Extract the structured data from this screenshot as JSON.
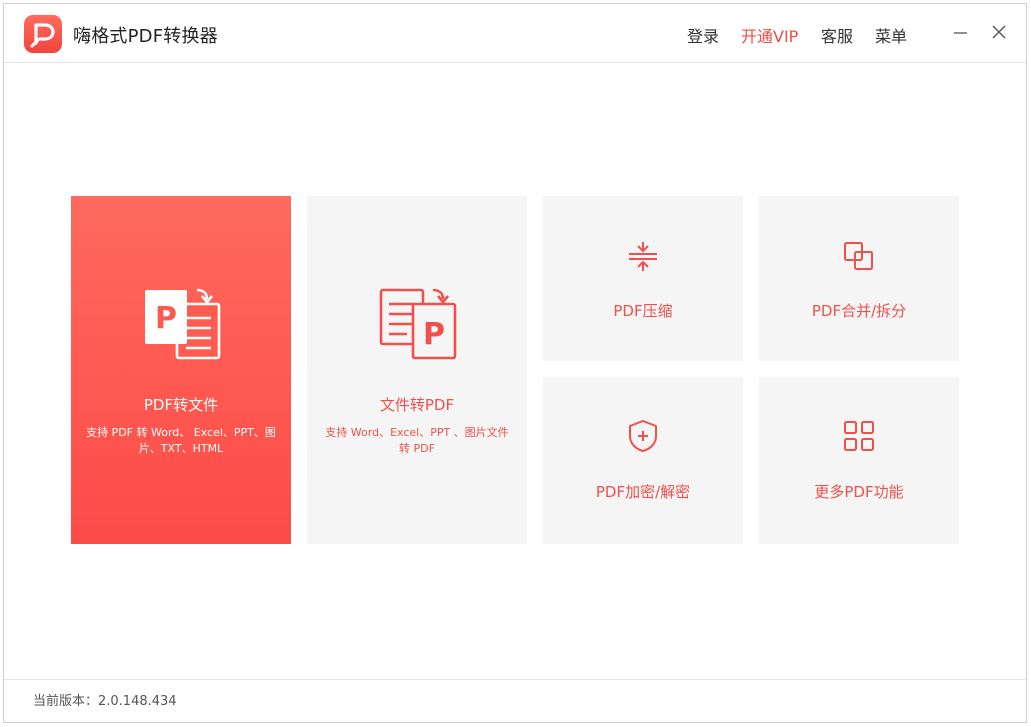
{
  "app": {
    "title": "嗨格式PDF转换器"
  },
  "header": {
    "login": "登录",
    "vip": "开通VIP",
    "service": "客服",
    "menu": "菜单"
  },
  "cards": {
    "pdf_to_file": {
      "title": "PDF转文件",
      "desc": "支持 PDF 转 Word、 Excel、PPT、图片、TXT、HTML"
    },
    "file_to_pdf": {
      "title": "文件转PDF",
      "desc": "支持 Word、Excel、PPT 、图片文件转 PDF"
    },
    "compress": {
      "title": "PDF压缩"
    },
    "merge_split": {
      "title": "PDF合并/拆分"
    },
    "encrypt": {
      "title": "PDF加密/解密"
    },
    "more": {
      "title": "更多PDF功能"
    }
  },
  "footer": {
    "version": "当前版本：2.0.148.434"
  },
  "colors": {
    "accent": "#f04b47",
    "card_bg": "#f5f5f5",
    "primary_top": "#fe6a5c",
    "primary_bottom": "#fd4b47"
  }
}
